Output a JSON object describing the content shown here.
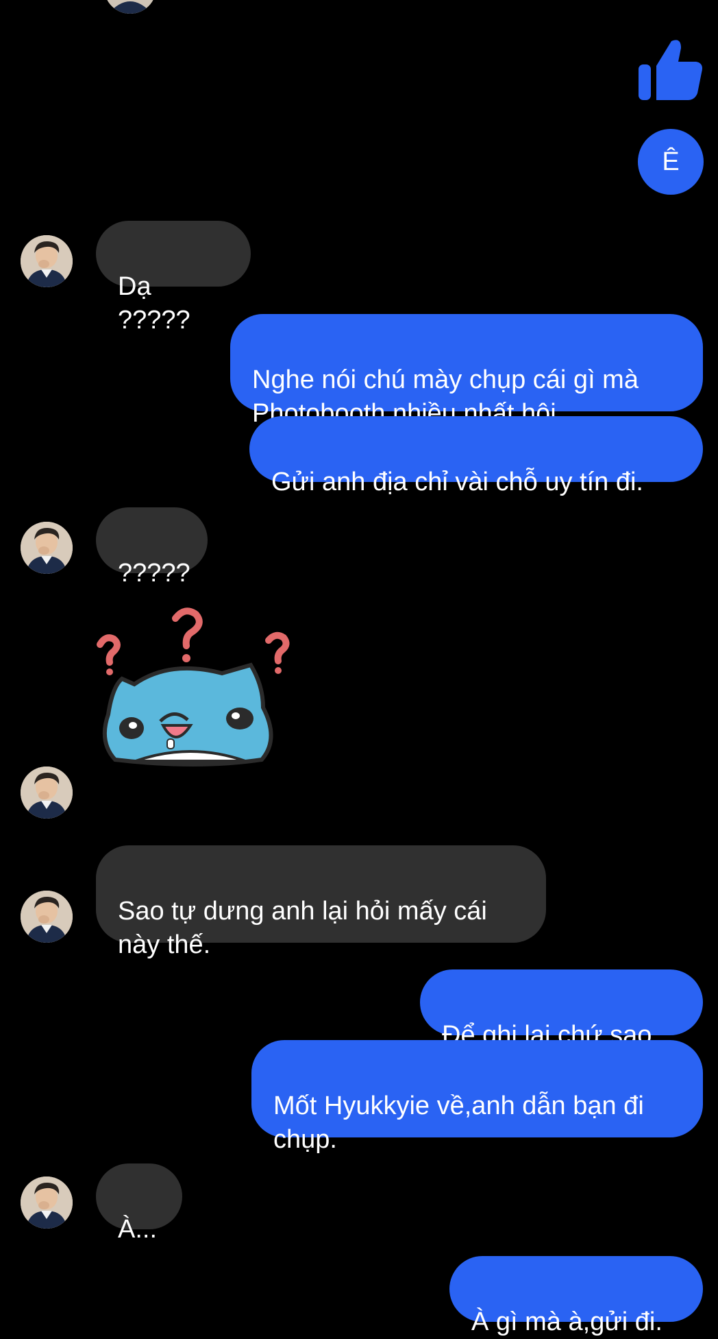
{
  "theme": {
    "background": "#000000",
    "incoming_bubble_color": "#303030",
    "outgoing_bubble_color": "#2a63f3"
  },
  "icons": {
    "like": "thumbs-up-icon",
    "avatar": "contact-avatar",
    "sticker": "blue-cat-question-sticker"
  },
  "messages": [
    {
      "side": "out",
      "type": "like"
    },
    {
      "side": "out",
      "text": "Ê"
    },
    {
      "side": "in",
      "text": "Dạ ?????"
    },
    {
      "side": "out",
      "text": "Nghe nói chú mày chụp cái gì mà Photobooth nhiều nhất hội."
    },
    {
      "side": "out",
      "text": "Gửi anh địa chỉ vài chỗ uy tín đi."
    },
    {
      "side": "in",
      "text": "?????"
    },
    {
      "side": "in",
      "type": "sticker"
    },
    {
      "side": "in",
      "text": "Sao tự dưng anh lại hỏi mấy cái này thế."
    },
    {
      "side": "out",
      "text": "Để ghi lại chứ sao."
    },
    {
      "side": "out",
      "text": "Mốt Hyukkyie về,anh dẫn bạn đi chụp."
    },
    {
      "side": "in",
      "text": "À..."
    },
    {
      "side": "out",
      "text": "À gì mà à,gửi đi."
    }
  ]
}
